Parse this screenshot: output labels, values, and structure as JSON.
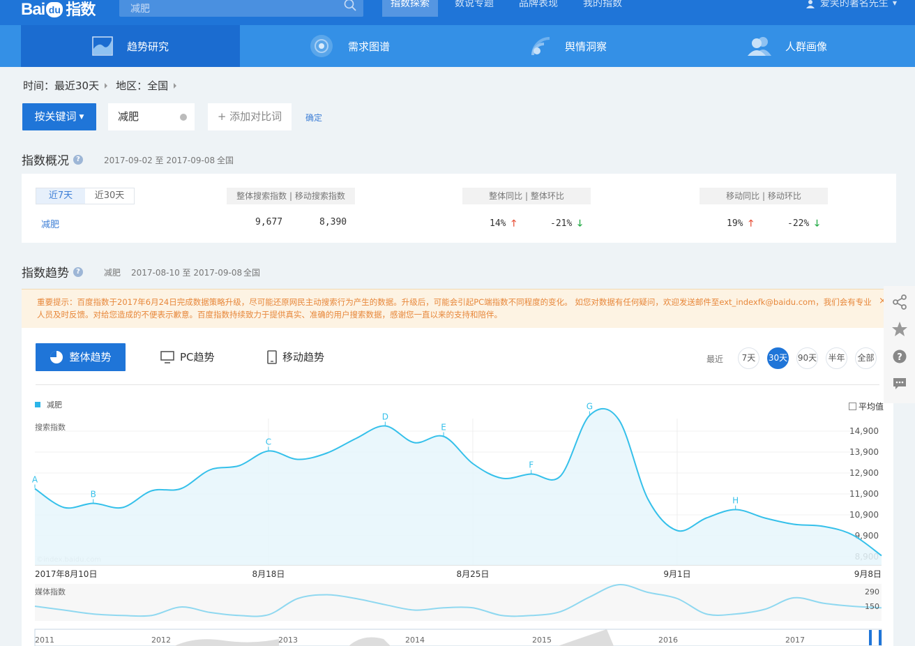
{
  "header": {
    "logo_latin": "Bai",
    "logo_paw": "du",
    "logo_cn": "指数",
    "search_placeholder": "减肥",
    "nav": [
      "指数探索",
      "数说专题",
      "品牌表现",
      "我的指数"
    ],
    "user": "爱笑的著名先生"
  },
  "subnav": [
    "趋势研究",
    "需求图谱",
    "舆情洞察",
    "人群画像"
  ],
  "filters": {
    "time": "时间：最近30天",
    "region": "地区：全国"
  },
  "keyword_bar": {
    "mode_button": "按关键词",
    "keyword": "减肥",
    "add_compare": "+ 添加对比词",
    "confirm": "确定"
  },
  "overview": {
    "title": "指数概况",
    "date_range": "2017-09-02 至 2017-09-08",
    "region": "全国",
    "tabs": [
      "近7天",
      "近30天"
    ],
    "header_search": "整体搜索指数  |  移动搜索指数",
    "header_overall": "整体同比  |  整体环比",
    "header_mobile": "移动同比  |  移动环比",
    "row": {
      "keyword": "减肥",
      "overall_index": "9,677",
      "mobile_index": "8,390",
      "overall_yoy": "14%",
      "overall_mom": "-21%",
      "mobile_yoy": "19%",
      "mobile_mom": "-22%"
    }
  },
  "trend": {
    "title": "指数趋势",
    "keyword": "减肥",
    "date_range": "2017-08-10 至 2017-09-08",
    "region": "全国",
    "notice": "重要提示：百度指数于2017年6月24日完成数据策略升级，尽可能还原网民主动搜索行为产生的数据。升级后，可能会引起PC端指数不同程度的变化。 如您对数据有任何疑问，欢迎发送邮件至ext_indexfk@baidu.com，我们会有专业人员及时反馈。对给您造成的不便表示歉意。百度指数持续致力于提供真实、准确的用户搜索数据，感谢您一直以来的支持和陪伴。",
    "notice_close": "×",
    "tabs": [
      "整体趋势",
      "PC趋势",
      "移动趋势"
    ],
    "recent_label": "最近",
    "ranges": [
      "7天",
      "30天",
      "90天",
      "半年",
      "全部"
    ],
    "legend": "减肥",
    "avg_label": "平均值",
    "watermark": "©index.baidu.com"
  },
  "chart_data": [
    {
      "type": "area",
      "ylabel": "搜索指数",
      "yticks": [
        8900,
        9900,
        10900,
        11900,
        12900,
        13900,
        14900
      ],
      "ytick_labels": [
        "8,900",
        "9,900",
        "10,900",
        "11,900",
        "12,900",
        "13,900",
        "14,900"
      ],
      "ylim": [
        8500,
        15500
      ],
      "x": [
        "2017-08-10",
        "2017-08-11",
        "2017-08-12",
        "2017-08-13",
        "2017-08-14",
        "2017-08-15",
        "2017-08-16",
        "2017-08-17",
        "2017-08-18",
        "2017-08-19",
        "2017-08-20",
        "2017-08-21",
        "2017-08-22",
        "2017-08-23",
        "2017-08-24",
        "2017-08-25",
        "2017-08-26",
        "2017-08-27",
        "2017-08-28",
        "2017-08-29",
        "2017-08-30",
        "2017-08-31",
        "2017-09-01",
        "2017-09-02",
        "2017-09-03",
        "2017-09-04",
        "2017-09-05",
        "2017-09-06",
        "2017-09-07",
        "2017-09-08"
      ],
      "values": [
        12150,
        11250,
        11450,
        11250,
        12050,
        12150,
        13050,
        13250,
        13950,
        13550,
        13850,
        14550,
        15150,
        14350,
        14650,
        13350,
        12650,
        12850,
        12750,
        15650,
        15450,
        11650,
        10150,
        10750,
        11150,
        10750,
        10450,
        10350,
        9950,
        8950
      ],
      "xtick_labels": [
        "2017年8月10日",
        "8月18日",
        "8月25日",
        "9月1日",
        "9月8日"
      ],
      "xtick_index": [
        0,
        8,
        15,
        22,
        29
      ],
      "markers": [
        {
          "label": "A",
          "index": 0
        },
        {
          "label": "B",
          "index": 2
        },
        {
          "label": "C",
          "index": 8
        },
        {
          "label": "D",
          "index": 12
        },
        {
          "label": "E",
          "index": 14
        },
        {
          "label": "F",
          "index": 17
        },
        {
          "label": "G",
          "index": 19
        },
        {
          "label": "H",
          "index": 24
        }
      ],
      "grid": true,
      "color": "#35c0ea"
    },
    {
      "type": "line",
      "ylabel": "媒体指数",
      "yticks": [
        150,
        290
      ],
      "ytick_labels": [
        "150",
        "290"
      ],
      "ylim": [
        55,
        295
      ],
      "values": [
        150,
        125,
        100,
        90,
        90,
        145,
        110,
        90,
        95,
        200,
        225,
        200,
        160,
        125,
        140,
        140,
        90,
        90,
        115,
        210,
        290,
        240,
        200,
        100,
        100,
        130,
        205,
        170,
        150,
        140
      ],
      "color": "#8fd8f0"
    }
  ],
  "timeline": {
    "years": [
      "2011",
      "2012",
      "2013",
      "2014",
      "2015",
      "2016",
      "2017"
    ]
  },
  "colors": {
    "brand": "#1f75d8",
    "subnav": "#3490e6",
    "line": "#35c0ea",
    "up": "#e8553e",
    "down": "#22aa44"
  }
}
